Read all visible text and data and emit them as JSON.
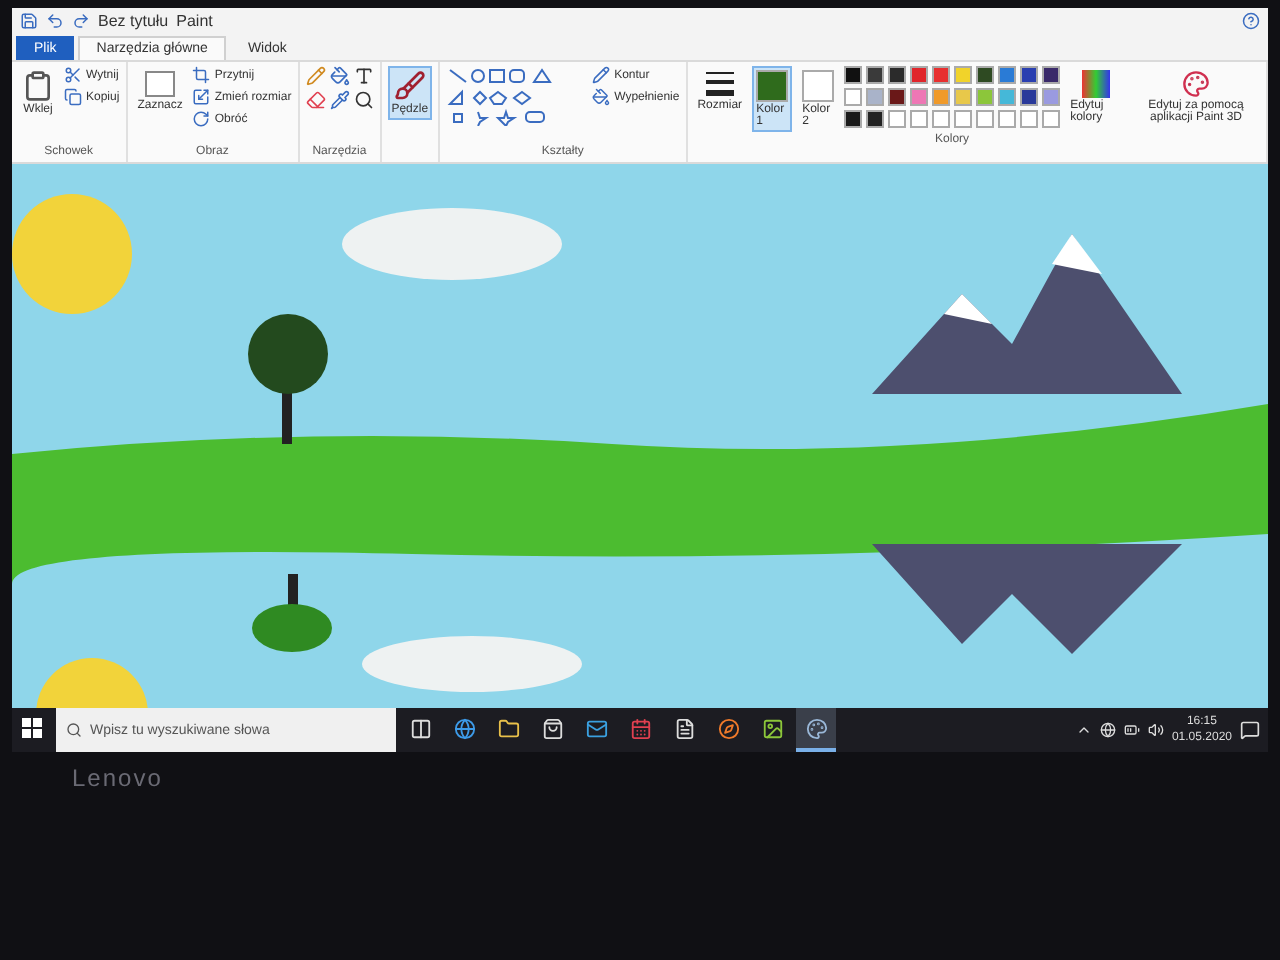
{
  "title_bar": {
    "document": "Bez tytułu",
    "app": "Paint"
  },
  "tabs": [
    {
      "label": "Plik",
      "kind": "file",
      "selected": false
    },
    {
      "label": "Narzędzia główne",
      "kind": "tab",
      "selected": true
    },
    {
      "label": "Widok",
      "kind": "tab",
      "selected": false
    }
  ],
  "ribbon": {
    "clipboard": {
      "name": "Schowek",
      "paste": "Wklej",
      "cut": "Wytnij",
      "copy": "Kopiuj"
    },
    "image": {
      "name": "Obraz",
      "select": "Zaznacz",
      "crop": "Przytnij",
      "resize": "Zmień rozmiar",
      "rotate": "Obróć"
    },
    "tools": {
      "name": "Narzędzia"
    },
    "brushes": {
      "label": "Pędzle",
      "selected": true
    },
    "shapes": {
      "name": "Kształty",
      "outline": "Kontur",
      "fill": "Wypełnienie"
    },
    "size": {
      "label": "Rozmiar"
    },
    "color_slots": [
      {
        "label": "Kolor 1",
        "color": "#2f6b1c",
        "selected": true
      },
      {
        "label": "Kolor 2",
        "color": "#ffffff",
        "selected": false
      }
    ],
    "colors": {
      "name": "Kolory",
      "swatches": [
        {
          "color": "#111111"
        },
        {
          "color": "#3a3a3a"
        },
        {
          "color": "#2b2b2b"
        },
        {
          "color": "#e0262b"
        },
        {
          "color": "#e83030"
        },
        {
          "color": "#f1d32a"
        },
        {
          "color": "#2e4a22"
        },
        {
          "color": "#2a7bd6"
        },
        {
          "color": "#2a3fb0"
        },
        {
          "color": "#3a2a6a"
        },
        {
          "color": "#ffffff"
        },
        {
          "color": "#a9b3c9"
        },
        {
          "color": "#6a1818"
        },
        {
          "color": "#ee77b5"
        },
        {
          "color": "#f09a2a"
        },
        {
          "color": "#e8c84a"
        },
        {
          "color": "#8cc63a"
        },
        {
          "color": "#45b8d8"
        },
        {
          "color": "#2a3a9a"
        },
        {
          "color": "#9a9ae0"
        },
        {
          "color": "#1a1a1a"
        },
        {
          "color": "#222222"
        },
        {
          "color": "#ffffff"
        },
        {
          "color": "#ffffff"
        },
        {
          "color": "#ffffff"
        },
        {
          "color": "#ffffff"
        },
        {
          "color": "#ffffff"
        },
        {
          "color": "#ffffff"
        },
        {
          "color": "#ffffff"
        },
        {
          "color": "#ffffff"
        }
      ]
    },
    "edit_colors": "Edytuj kolory",
    "paint3d": "Edytuj za pomocą aplikacji Paint 3D"
  },
  "taskbar": {
    "search": {
      "placeholder": "Wpisz tu wyszukiwane słowa"
    },
    "apps": [
      {
        "kind": "task-view",
        "selected": false
      },
      {
        "kind": "edge",
        "selected": false
      },
      {
        "kind": "explorer",
        "selected": false
      },
      {
        "kind": "store",
        "selected": false
      },
      {
        "kind": "mail",
        "selected": false
      },
      {
        "kind": "calendar",
        "selected": false
      },
      {
        "kind": "document",
        "selected": false
      },
      {
        "kind": "firefox",
        "selected": false
      },
      {
        "kind": "photos",
        "selected": false
      },
      {
        "kind": "paint",
        "selected": true
      }
    ],
    "time": "16:15",
    "date": "01.05.2020"
  },
  "bezel": {
    "logo": "Lenovo"
  }
}
